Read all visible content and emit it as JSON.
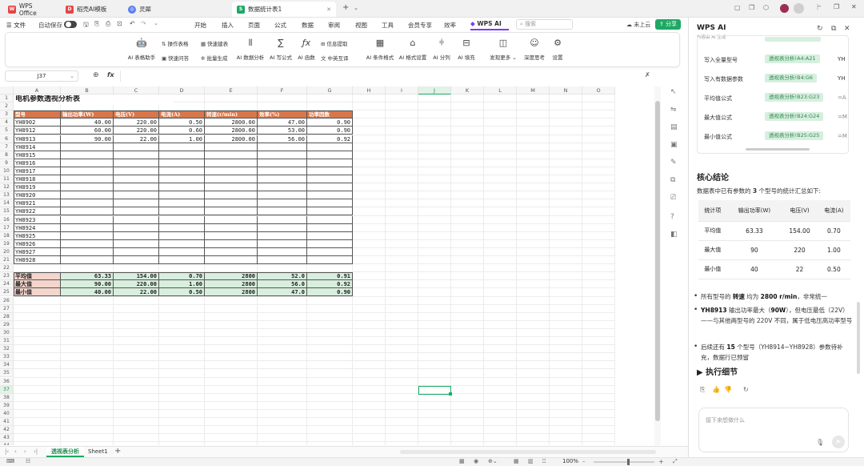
{
  "window": {
    "tabs": [
      {
        "label": "WPS Office",
        "icon": "wps-icon"
      },
      {
        "label": "稻壳AI模板",
        "icon": "docer-icon"
      },
      {
        "label": "灵犀",
        "icon": "lingxi-icon"
      },
      {
        "label": "数据统计表1",
        "icon": "sheet-icon"
      }
    ]
  },
  "menu": {
    "file": "文件",
    "autosave": "自动保存",
    "items": [
      "开始",
      "插入",
      "页面",
      "公式",
      "数据",
      "审阅",
      "视图",
      "工具",
      "会员专享",
      "效率"
    ],
    "wps_ai": "WPS AI",
    "search": "搜索",
    "cloud": "未上云",
    "share": "分享"
  },
  "ribbon": {
    "big": [
      {
        "label": "AI 表格助手",
        "icon": "robot-icon"
      },
      {
        "label": "AI 数据分析",
        "icon": "chart-icon"
      },
      {
        "label": "AI 写公式",
        "icon": "sigma-icon"
      },
      {
        "label": "AI 函数",
        "icon": "fx-icon"
      },
      {
        "label": "AI 条件格式",
        "icon": "grid-icon"
      },
      {
        "label": "AI 格式设置",
        "icon": "brush-icon"
      },
      {
        "label": "AI 分列",
        "icon": "split-icon"
      },
      {
        "label": "AI 填充",
        "icon": "fill-icon"
      },
      {
        "label": "发现更多",
        "icon": "discover-icon"
      },
      {
        "label": "深度思考",
        "icon": "think-icon"
      },
      {
        "label": "设置",
        "icon": "settings-icon"
      }
    ],
    "small": [
      "操作表格",
      "快速建表",
      "快速问答",
      "批量生成",
      "信息提取",
      "中英互译"
    ]
  },
  "formula": {
    "cell": "J37",
    "fx": "fx"
  },
  "sheet": {
    "columns": [
      "A",
      "B",
      "C",
      "D",
      "E",
      "F",
      "G",
      "H",
      "I",
      "J",
      "K",
      "L",
      "M",
      "N",
      "O"
    ],
    "title": "电机参数透视分析表",
    "headers": [
      "型号",
      "输出功率(W)",
      "电压(V)",
      "电流(A)",
      "转速(r/min)",
      "效率(%)",
      "功率因数"
    ],
    "rows": [
      [
        "YH8902",
        "40.00",
        "220.00",
        "0.50",
        "2800.00",
        "47.00",
        "0.90"
      ],
      [
        "YH8912",
        "60.00",
        "220.00",
        "0.60",
        "2800.00",
        "53.00",
        "0.90"
      ],
      [
        "YH8913",
        "90.00",
        "22.00",
        "1.00",
        "2800.00",
        "56.00",
        "0.92"
      ],
      [
        "YH8914",
        "",
        "",
        "",
        "",
        "",
        ""
      ],
      [
        "YH8915",
        "",
        "",
        "",
        "",
        "",
        ""
      ],
      [
        "YH8916",
        "",
        "",
        "",
        "",
        "",
        ""
      ],
      [
        "YH8917",
        "",
        "",
        "",
        "",
        "",
        ""
      ],
      [
        "YH8918",
        "",
        "",
        "",
        "",
        "",
        ""
      ],
      [
        "YH8919",
        "",
        "",
        "",
        "",
        "",
        ""
      ],
      [
        "YH8920",
        "",
        "",
        "",
        "",
        "",
        ""
      ],
      [
        "YH8921",
        "",
        "",
        "",
        "",
        "",
        ""
      ],
      [
        "YH8922",
        "",
        "",
        "",
        "",
        "",
        ""
      ],
      [
        "YH8923",
        "",
        "",
        "",
        "",
        "",
        ""
      ],
      [
        "YH8924",
        "",
        "",
        "",
        "",
        "",
        ""
      ],
      [
        "YH8925",
        "",
        "",
        "",
        "",
        "",
        ""
      ],
      [
        "YH8926",
        "",
        "",
        "",
        "",
        "",
        ""
      ],
      [
        "YH8927",
        "",
        "",
        "",
        "",
        "",
        ""
      ],
      [
        "YH8928",
        "",
        "",
        "",
        "",
        "",
        ""
      ]
    ],
    "summary": [
      [
        "平均值",
        "63.33",
        "154.00",
        "0.70",
        "2800",
        "52.0",
        "0.91"
      ],
      [
        "最大值",
        "90.00",
        "220.00",
        "1.00",
        "2800",
        "56.0",
        "0.92"
      ],
      [
        "最小值",
        "40.00",
        "22.00",
        "0.50",
        "2800",
        "47.0",
        "0.90"
      ]
    ],
    "row_numbers": [
      "1",
      "2",
      "3",
      "4",
      "5",
      "6",
      "7",
      "8",
      "9",
      "10",
      "11",
      "12",
      "13",
      "14",
      "15",
      "16",
      "17",
      "18",
      "19",
      "20",
      "21",
      "22",
      "23",
      "24",
      "25",
      "26",
      "27",
      "28",
      "29",
      "30",
      "31",
      "32",
      "33",
      "34",
      "35",
      "36",
      "37",
      "38",
      "39",
      "40",
      "41",
      "42",
      "43",
      "44"
    ],
    "sheet_tabs": [
      "透视表分析",
      "Sheet1"
    ],
    "add_sheet": "+"
  },
  "status": {
    "zoom": "100%"
  },
  "ai_panel": {
    "title": "WPS AI",
    "subtitle": "内容由 AI 生成",
    "formula_rows": [
      {
        "label": "写入全量型号",
        "ref": "透视表分析!A4:A21",
        "extra": "YH"
      },
      {
        "label": "写入有数据参数",
        "ref": "透视表分析!B4:G6",
        "extra": "YH"
      },
      {
        "label": "平均值公式",
        "ref": "透视表分析!B23:G23",
        "extra": "=A"
      },
      {
        "label": "最大值公式",
        "ref": "透视表分析!B24:G24",
        "extra": "=M"
      },
      {
        "label": "最小值公式",
        "ref": "透视表分析!B25:G25",
        "extra": "=M"
      }
    ],
    "conclusion_title": "核心结论",
    "conclusion_intro_pre": "数据表中已有参数的 ",
    "conclusion_intro_num": "3",
    "conclusion_intro_post": " 个型号的统计汇总如下:",
    "table_headers": [
      "统计项",
      "输出功率(W)",
      "电压(V)",
      "电流(A)"
    ],
    "table_rows": [
      [
        "平均值",
        "63.33",
        "154.00",
        "0.70"
      ],
      [
        "最大值",
        "90",
        "220",
        "1.00"
      ],
      [
        "最小值",
        "40",
        "22",
        "0.50"
      ]
    ],
    "bullets": [
      {
        "pre": "所有型号的 ",
        "b1": "转速",
        "mid": " 均为 ",
        "b2": "2800 r/min",
        "post": "，非常统一"
      },
      {
        "pre": "",
        "b1": "YH8913",
        "mid": " 输出功率最大（",
        "b2": "90W",
        "post": "），但电压最低（22V）——与其他两型号的 220V 不同，属于低电压高功率型号"
      },
      {
        "pre": "后续还有 ",
        "b1": "15",
        "mid": " 个型号（YH8914~YH8928）参数待补充，数据行已预留",
        "b2": "",
        "post": ""
      }
    ],
    "details_label": "执行细节",
    "input_placeholder": "接下来想做什么"
  }
}
